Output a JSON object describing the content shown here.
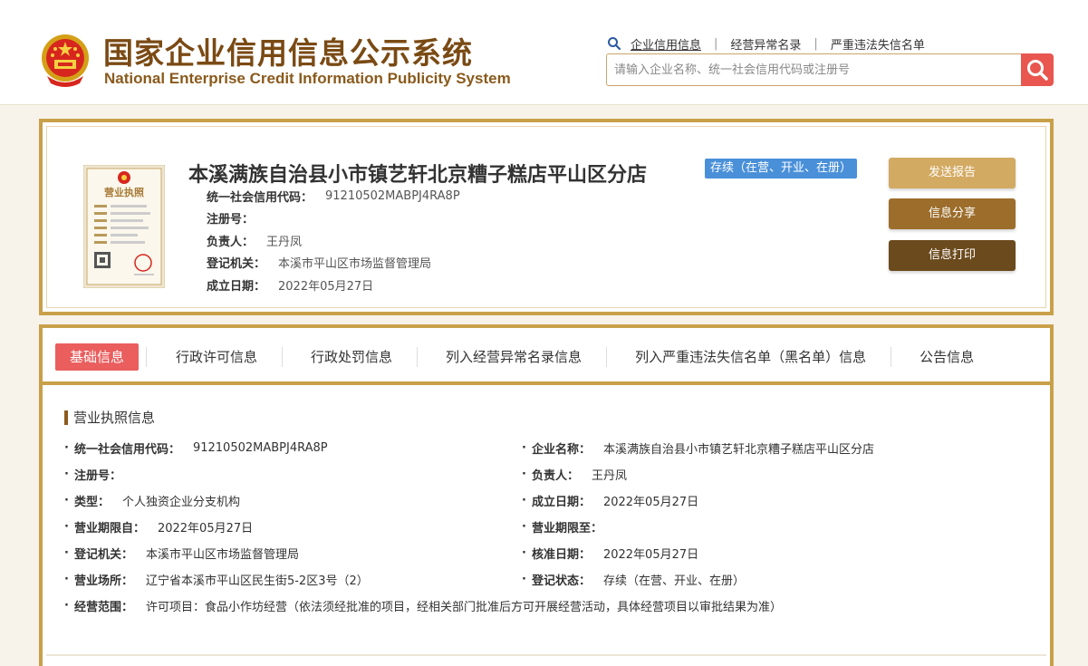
{
  "header": {
    "title_cn": "国家企业信用信息公示系统",
    "title_en": "National Enterprise Credit Information Publicity System",
    "nav": [
      {
        "label": "企业信用信息"
      },
      {
        "label": "经营异常名录"
      },
      {
        "label": "严重违法失信名单"
      }
    ],
    "search": {
      "placeholder": "请输入企业名称、统一社会信用代码或注册号",
      "value": ""
    }
  },
  "company": {
    "name": "本溪满族自治县小市镇艺轩北京糟子糕店平山区分店",
    "status": "存续（在营、开业、在册）",
    "license_image": {
      "title": "营业执照"
    },
    "info": [
      {
        "label": "统一社会信用代码：",
        "value": "91210502MABPJ4RA8P"
      },
      {
        "label": "注册号：",
        "value": ""
      },
      {
        "label": "负责人：",
        "value": "王丹凤"
      },
      {
        "label": "登记机关：",
        "value": "本溪市平山区市场监督管理局"
      },
      {
        "label": "成立日期：",
        "value": "2022年05月27日"
      }
    ],
    "actions": {
      "report": "发送报告",
      "share": "信息分享",
      "print": "信息打印"
    }
  },
  "tabs": [
    {
      "label": "基础信息"
    },
    {
      "label": "行政许可信息"
    },
    {
      "label": "行政处罚信息"
    },
    {
      "label": "列入经营异常名录信息"
    },
    {
      "label": "列入严重违法失信名单（黑名单）信息"
    },
    {
      "label": "公告信息"
    }
  ],
  "section_title": "营业执照信息",
  "fields": {
    "left": [
      {
        "label": "统一社会信用代码：",
        "value": "91210502MABPJ4RA8P"
      },
      {
        "label": "注册号：",
        "value": ""
      },
      {
        "label": "类型：",
        "value": "个人独资企业分支机构"
      },
      {
        "label": "营业期限自：",
        "value": "2022年05月27日"
      },
      {
        "label": "登记机关：",
        "value": "本溪市平山区市场监督管理局"
      },
      {
        "label": "营业场所：",
        "value": "辽宁省本溪市平山区民生街5-2区3号（2）"
      },
      {
        "label": "经营范围：",
        "value": "许可项目：食品小作坊经营（依法须经批准的项目，经相关部门批准后方可开展经营活动，具体经营项目以审批结果为准）"
      }
    ],
    "right": [
      {
        "label": "企业名称：",
        "value": "本溪满族自治县小市镇艺轩北京糟子糕店平山区分店"
      },
      {
        "label": "负责人：",
        "value": "王丹凤"
      },
      {
        "label": "成立日期：",
        "value": "2022年05月27日"
      },
      {
        "label": "营业期限至：",
        "value": ""
      },
      {
        "label": "核准日期：",
        "value": "2022年05月27日"
      },
      {
        "label": "登记状态：",
        "value": "存续（在营、开业、在册）"
      }
    ]
  },
  "colors": {
    "gold": "#c9a04a",
    "brown": "#7a4a14",
    "active_tab": "#ea5e5e",
    "status_blue": "#4a90d9",
    "search_red": "#e8564f"
  }
}
